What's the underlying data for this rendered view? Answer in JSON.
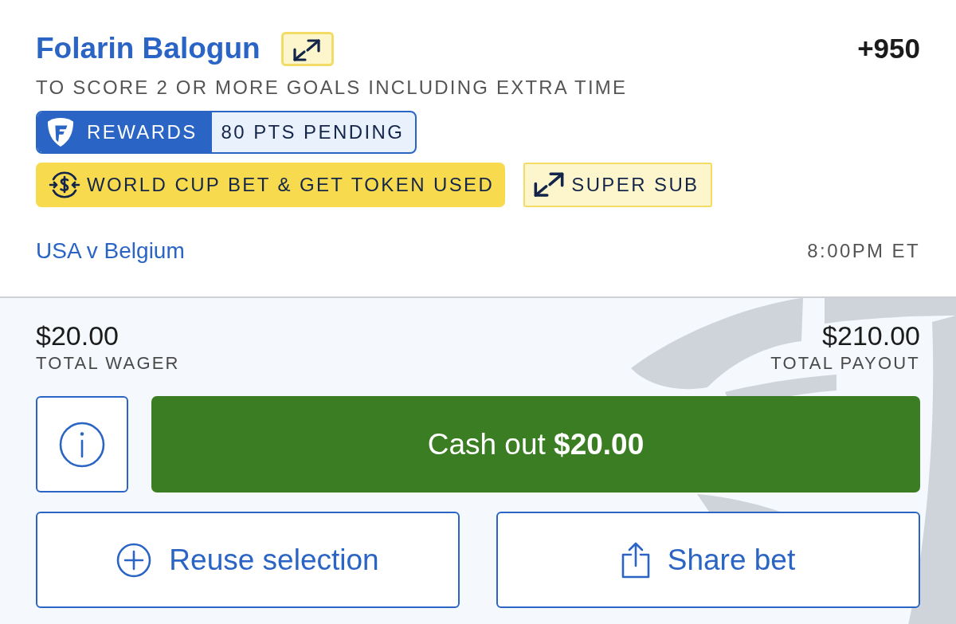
{
  "selection": {
    "player": "Folarin Balogun",
    "super_sub": true,
    "odds": "+950",
    "market": "TO SCORE 2 OR MORE GOALS INCLUDING EXTRA TIME"
  },
  "rewards": {
    "label": "REWARDS",
    "points": "80 PTS PENDING"
  },
  "promos": [
    {
      "kind": "token",
      "label": "WORLD CUP BET & GET TOKEN USED"
    },
    {
      "kind": "super_sub",
      "label": "SUPER SUB"
    }
  ],
  "event": {
    "name": "USA v Belgium",
    "time": "8:00PM ET"
  },
  "totals": [
    {
      "kind": "wager",
      "amount": "$20.00",
      "label": "TOTAL WAGER"
    },
    {
      "kind": "payout",
      "amount": "$210.00",
      "label": "TOTAL PAYOUT"
    }
  ],
  "cash_out": {
    "label": "Cash out **$20.00**"
  },
  "actions": [
    {
      "kind": "reuse",
      "label": "Reuse selection"
    },
    {
      "kind": "share",
      "label": "Share bet"
    }
  ]
}
